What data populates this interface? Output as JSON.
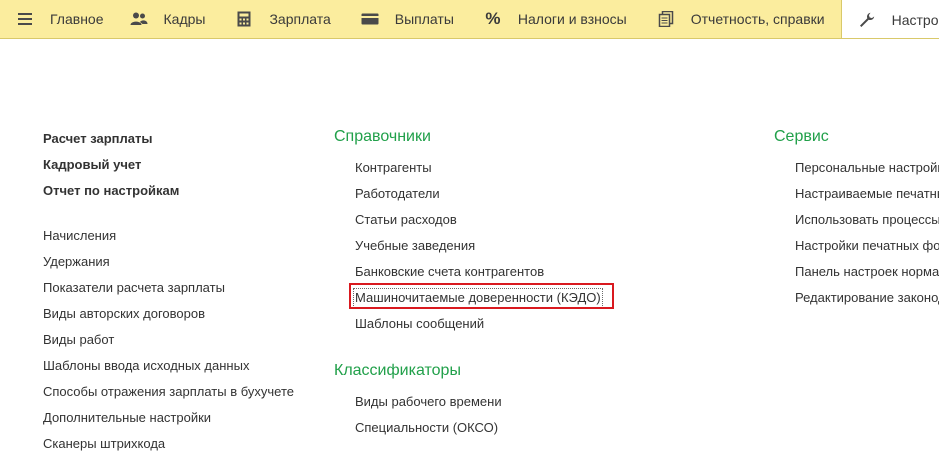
{
  "tabs": [
    {
      "label": "Главное",
      "icon": "menu-icon"
    },
    {
      "label": "Кадры",
      "icon": "people-icon"
    },
    {
      "label": "Зарплата",
      "icon": "calculator-icon"
    },
    {
      "label": "Выплаты",
      "icon": "wallet-icon"
    },
    {
      "label": "Налоги и взносы",
      "icon": "percent-icon"
    },
    {
      "label": "Отчетность, справки",
      "icon": "documents-icon"
    },
    {
      "label": "Настройка",
      "icon": "wrench-icon",
      "active": true
    },
    {
      "label": "",
      "icon": "gear-icon"
    }
  ],
  "left_column": {
    "bold_items": [
      "Расчет зарплаты",
      "Кадровый учет",
      "Отчет по настройкам"
    ],
    "items": [
      "Начисления",
      "Удержания",
      "Показатели расчета зарплаты",
      "Виды авторских договоров",
      "Виды работ",
      "Шаблоны ввода исходных данных",
      "Способы отражения зарплаты в бухучете",
      "Дополнительные настройки",
      "Сканеры штрихкода"
    ]
  },
  "middle_column": {
    "directories_heading": "Справочники",
    "directories": [
      "Контрагенты",
      "Работодатели",
      "Статьи расходов",
      "Учебные заведения",
      "Банковские счета контрагентов",
      "Машиночитаемые доверенности (КЭДО)",
      "Шаблоны сообщений"
    ],
    "classifiers_heading": "Классификаторы",
    "classifiers": [
      "Виды рабочего времени",
      "Специальности (ОКСО)"
    ]
  },
  "right_column": {
    "heading": "Сервис",
    "items": [
      "Персональные настройки",
      "Настраиваемые печатные формы",
      "Использовать процессы",
      "Настройки печатных форм",
      "Панель настроек нормативных документов",
      "Редактирование законодательства"
    ]
  },
  "colors": {
    "topbar": "#fbed9e",
    "heading_green": "#21a04a",
    "highlight_red": "#d9191f"
  }
}
